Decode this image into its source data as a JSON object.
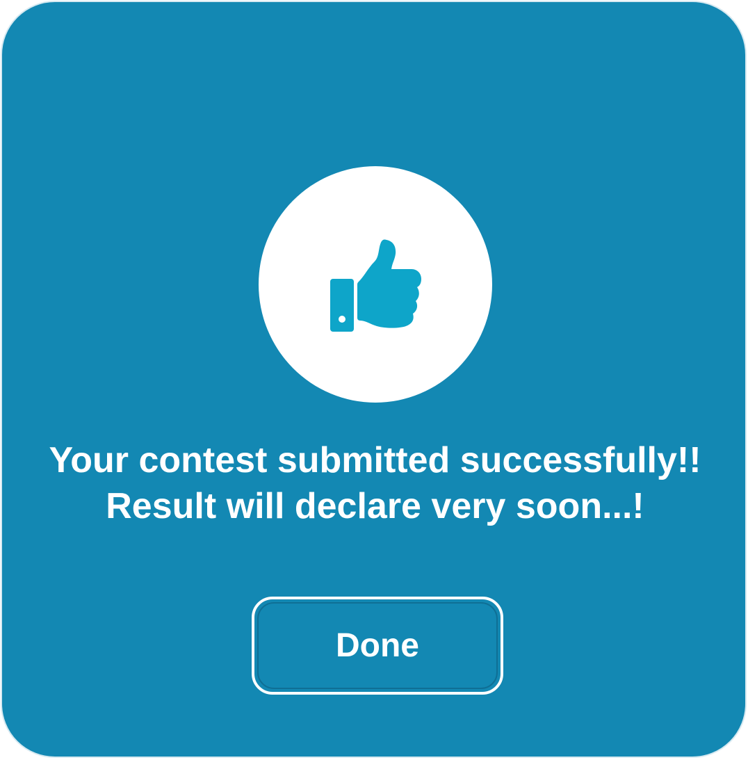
{
  "dialog": {
    "icon": "thumbs-up-icon",
    "message_line1": "Your contest submitted successfully!!",
    "message_line2": "Result will declare very soon...!",
    "done_label": "Done"
  },
  "colors": {
    "background": "#1388b3",
    "icon_circle": "#ffffff",
    "icon": "#0ea5c9",
    "text": "#ffffff"
  }
}
